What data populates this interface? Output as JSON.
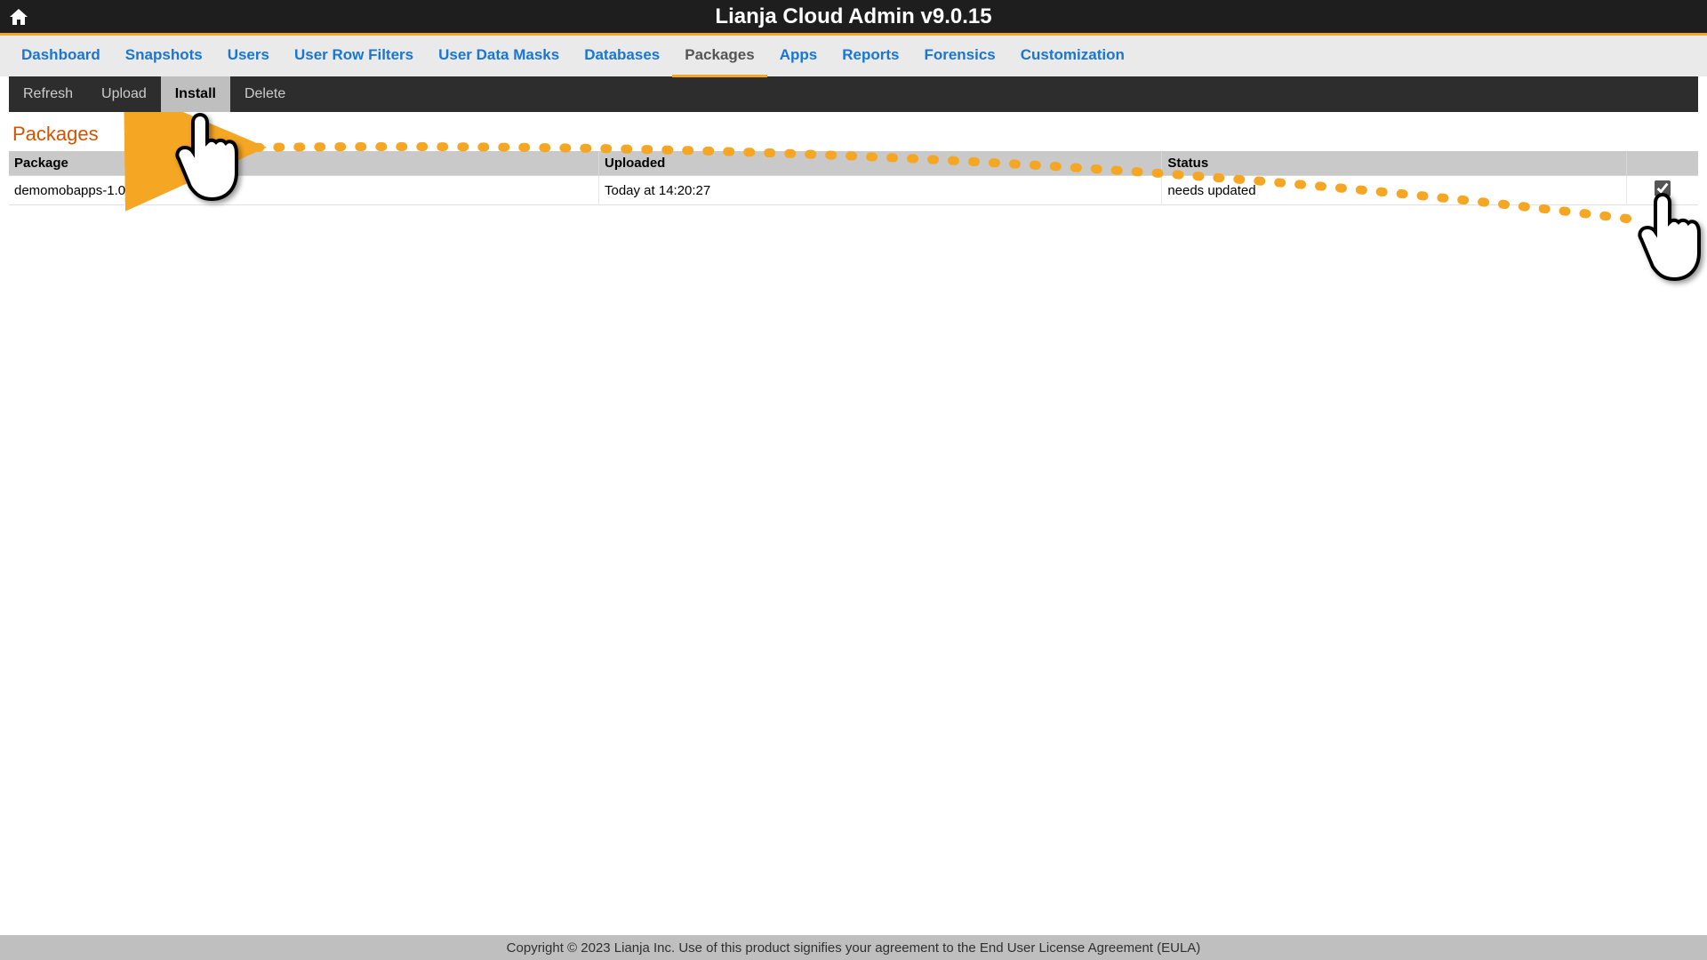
{
  "header": {
    "title": "Lianja Cloud Admin v9.0.15"
  },
  "nav": {
    "items": [
      {
        "label": "Dashboard",
        "active": false
      },
      {
        "label": "Snapshots",
        "active": false
      },
      {
        "label": "Users",
        "active": false
      },
      {
        "label": "User Row Filters",
        "active": false
      },
      {
        "label": "User Data Masks",
        "active": false
      },
      {
        "label": "Databases",
        "active": false
      },
      {
        "label": "Packages",
        "active": true
      },
      {
        "label": "Apps",
        "active": false
      },
      {
        "label": "Reports",
        "active": false
      },
      {
        "label": "Forensics",
        "active": false
      },
      {
        "label": "Customization",
        "active": false
      }
    ]
  },
  "toolbar": {
    "items": [
      {
        "label": "Refresh",
        "active": false
      },
      {
        "label": "Upload",
        "active": false
      },
      {
        "label": "Install",
        "active": true
      },
      {
        "label": "Delete",
        "active": false
      }
    ]
  },
  "section": {
    "title": "Packages"
  },
  "table": {
    "headers": {
      "package": "Package",
      "uploaded": "Uploaded",
      "status": "Status",
      "checkbox": ""
    },
    "rows": [
      {
        "package": "demomobapps-1.0",
        "uploaded": "Today at 14:20:27",
        "status": "needs updated",
        "checked": true
      }
    ]
  },
  "footer": {
    "text": "Copyright © 2023 Lianja Inc. Use of this product signifies your agreement to the End User License Agreement (EULA)"
  },
  "annotation": {
    "accent": "#f5a623"
  }
}
